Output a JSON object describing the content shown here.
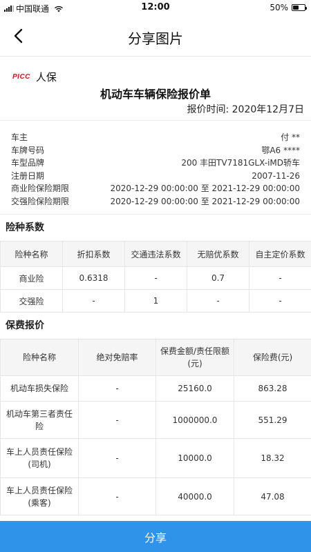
{
  "status_bar": {
    "carrier": "中国联通",
    "time": "12:00",
    "battery": "50%",
    "battery_level": 0.5
  },
  "nav": {
    "title": "分享图片"
  },
  "header": {
    "brand_logo": "PICC",
    "brand_name": "人保",
    "doc_title": "机动车车辆保险报价单",
    "quote_time": "报价时间: 2020年12月7日"
  },
  "info": [
    {
      "label": "车主",
      "value": "付 **"
    },
    {
      "label": "车牌号码",
      "value": "鄂A6 ****"
    },
    {
      "label": "车型品牌",
      "value": "200 丰田TV7181GLX-iMD轿车"
    },
    {
      "label": "注册日期",
      "value": "2007-11-26"
    },
    {
      "label": "商业险保险期限",
      "value": "2020-12-29 00:00:00 至 2021-12-29 00:00:00"
    },
    {
      "label": "交强险保险期限",
      "value": "2020-12-29 00:00:00 至 2021-12-29 00:00:00"
    }
  ],
  "coefficients": {
    "title": "险种系数",
    "headers": [
      "险种名称",
      "折扣系数",
      "交通违法系数",
      "无赔优系数",
      "自主定价系数"
    ],
    "rows": [
      [
        "商业险",
        "0.6318",
        "-",
        "0.7",
        "-"
      ],
      [
        "交强险",
        "-",
        "1",
        "-",
        "-"
      ]
    ]
  },
  "premium": {
    "title": "保费报价",
    "headers": [
      "险种名称",
      "绝对免赔率",
      "保费金额/责任限额(元)",
      "保险费(元)"
    ],
    "rows": [
      [
        "机动车损失保险",
        "-",
        "25160.0",
        "863.28"
      ],
      [
        "机动车第三者责任险",
        "-",
        "1000000.0",
        "551.29"
      ],
      [
        "车上人员责任保险(司机)",
        "-",
        "10000.0",
        "18.32"
      ],
      [
        "车上人员责任保险(乘客)",
        "-",
        "40000.0",
        "47.08"
      ]
    ]
  },
  "share_button": {
    "label": "分享"
  }
}
